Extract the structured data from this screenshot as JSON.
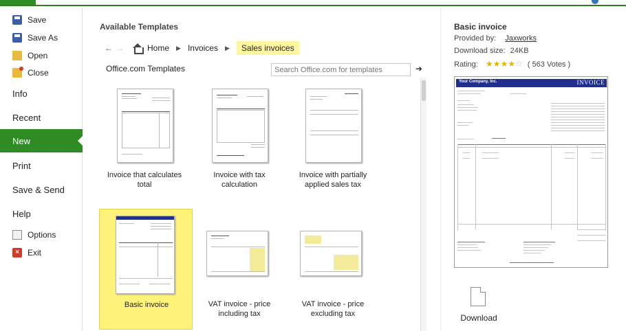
{
  "nav": {
    "save": "Save",
    "save_as": "Save As",
    "open": "Open",
    "close": "Close",
    "info": "Info",
    "recent": "Recent",
    "new": "New",
    "print": "Print",
    "save_send": "Save & Send",
    "help": "Help",
    "options": "Options",
    "exit": "Exit"
  },
  "main": {
    "title": "Available Templates",
    "breadcrumb": [
      "Home",
      "Invoices",
      "Sales invoices"
    ],
    "section_label": "Office.com Templates",
    "search_placeholder": "Search Office.com for templates",
    "templates": [
      {
        "label_line1": "Invoice that calculates",
        "label_line2": "total",
        "selected": false
      },
      {
        "label_line1": "Invoice with tax",
        "label_line2": "calculation",
        "selected": false
      },
      {
        "label_line1": "Invoice with partially",
        "label_line2": "applied sales tax",
        "selected": false
      },
      {
        "label_line1": "Basic invoice",
        "label_line2": "",
        "selected": true
      },
      {
        "label_line1": "VAT invoice - price",
        "label_line2": "including tax",
        "selected": false
      },
      {
        "label_line1": "VAT invoice - price",
        "label_line2": "excluding tax",
        "selected": false
      }
    ]
  },
  "preview": {
    "title": "Basic invoice",
    "provided_by_label": "Provided by:",
    "provider": "Jaxworks",
    "download_size_label": "Download size:",
    "download_size": "24KB",
    "rating_label": "Rating:",
    "rating_stars": 4,
    "rating_max": 5,
    "votes": "( 563 Votes )",
    "doc_company": "Your Company, Inc.",
    "doc_heading": "INVOICE",
    "download_label": "Download"
  },
  "colors": {
    "accent_green": "#2f8c25",
    "selected_tile": "#fff27a",
    "breadcrumb_highlight": "#fff6a0",
    "invoice_band": "#1f2f8f",
    "star": "#e8b400"
  }
}
